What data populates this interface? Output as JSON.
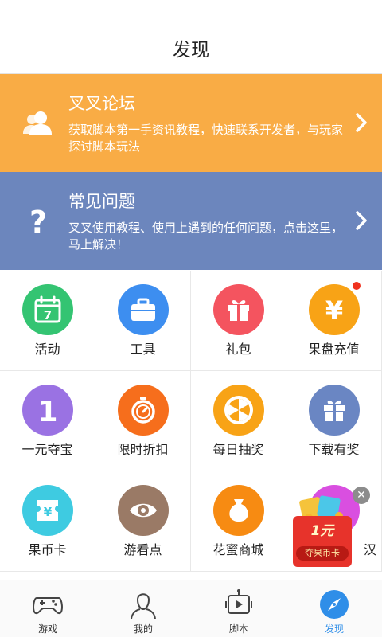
{
  "header": {
    "title": "发现"
  },
  "banners": [
    {
      "title": "叉叉论坛",
      "desc": "获取脚本第一手资讯教程，快速联系开发者，与玩家探讨脚本玩法",
      "icon": "users-icon",
      "color": "#f9ac45"
    },
    {
      "title": "常见问题",
      "desc": "叉叉使用教程、使用上遇到的任何问题，点击这里，马上解决！",
      "icon": "question-icon",
      "color": "#6c86bd"
    }
  ],
  "grid": [
    {
      "label": "活动",
      "icon": "calendar-icon",
      "color": "#34c472"
    },
    {
      "label": "工具",
      "icon": "toolbox-icon",
      "color": "#3d8ef0"
    },
    {
      "label": "礼包",
      "icon": "gift-icon",
      "color": "#f4545f"
    },
    {
      "label": "果盘充值",
      "icon": "yen-icon",
      "color": "#f8a316",
      "badge": true
    },
    {
      "label": "一元夺宝",
      "icon": "one-icon",
      "color": "#9a72e3"
    },
    {
      "label": "限时折扣",
      "icon": "stopwatch-icon",
      "color": "#f66e1c"
    },
    {
      "label": "每日抽奖",
      "icon": "wheel-icon",
      "color": "#f8a316"
    },
    {
      "label": "下载有奖",
      "icon": "gift-box-icon",
      "color": "#6a86c3"
    },
    {
      "label": "果币卡",
      "icon": "yen-ticket-icon",
      "color": "#3ecbe1"
    },
    {
      "label": "游看点",
      "icon": "eye-icon",
      "color": "#9a7a66"
    },
    {
      "label": "花蜜商城",
      "icon": "pouch-icon",
      "color": "#f78b12"
    },
    {
      "label": "汉",
      "icon": "",
      "color": "#d94fe0"
    }
  ],
  "promo": {
    "amount": "1元",
    "label": "夺果币卡",
    "close": "✕"
  },
  "tabs": [
    {
      "label": "游戏",
      "icon": "gamepad-icon",
      "active": false
    },
    {
      "label": "我的",
      "icon": "person-icon",
      "active": false
    },
    {
      "label": "脚本",
      "icon": "robot-icon",
      "active": false
    },
    {
      "label": "发现",
      "icon": "compass-icon",
      "active": true
    }
  ],
  "colors": {
    "accent": "#2f8ee8",
    "badge": "#f0321e"
  }
}
